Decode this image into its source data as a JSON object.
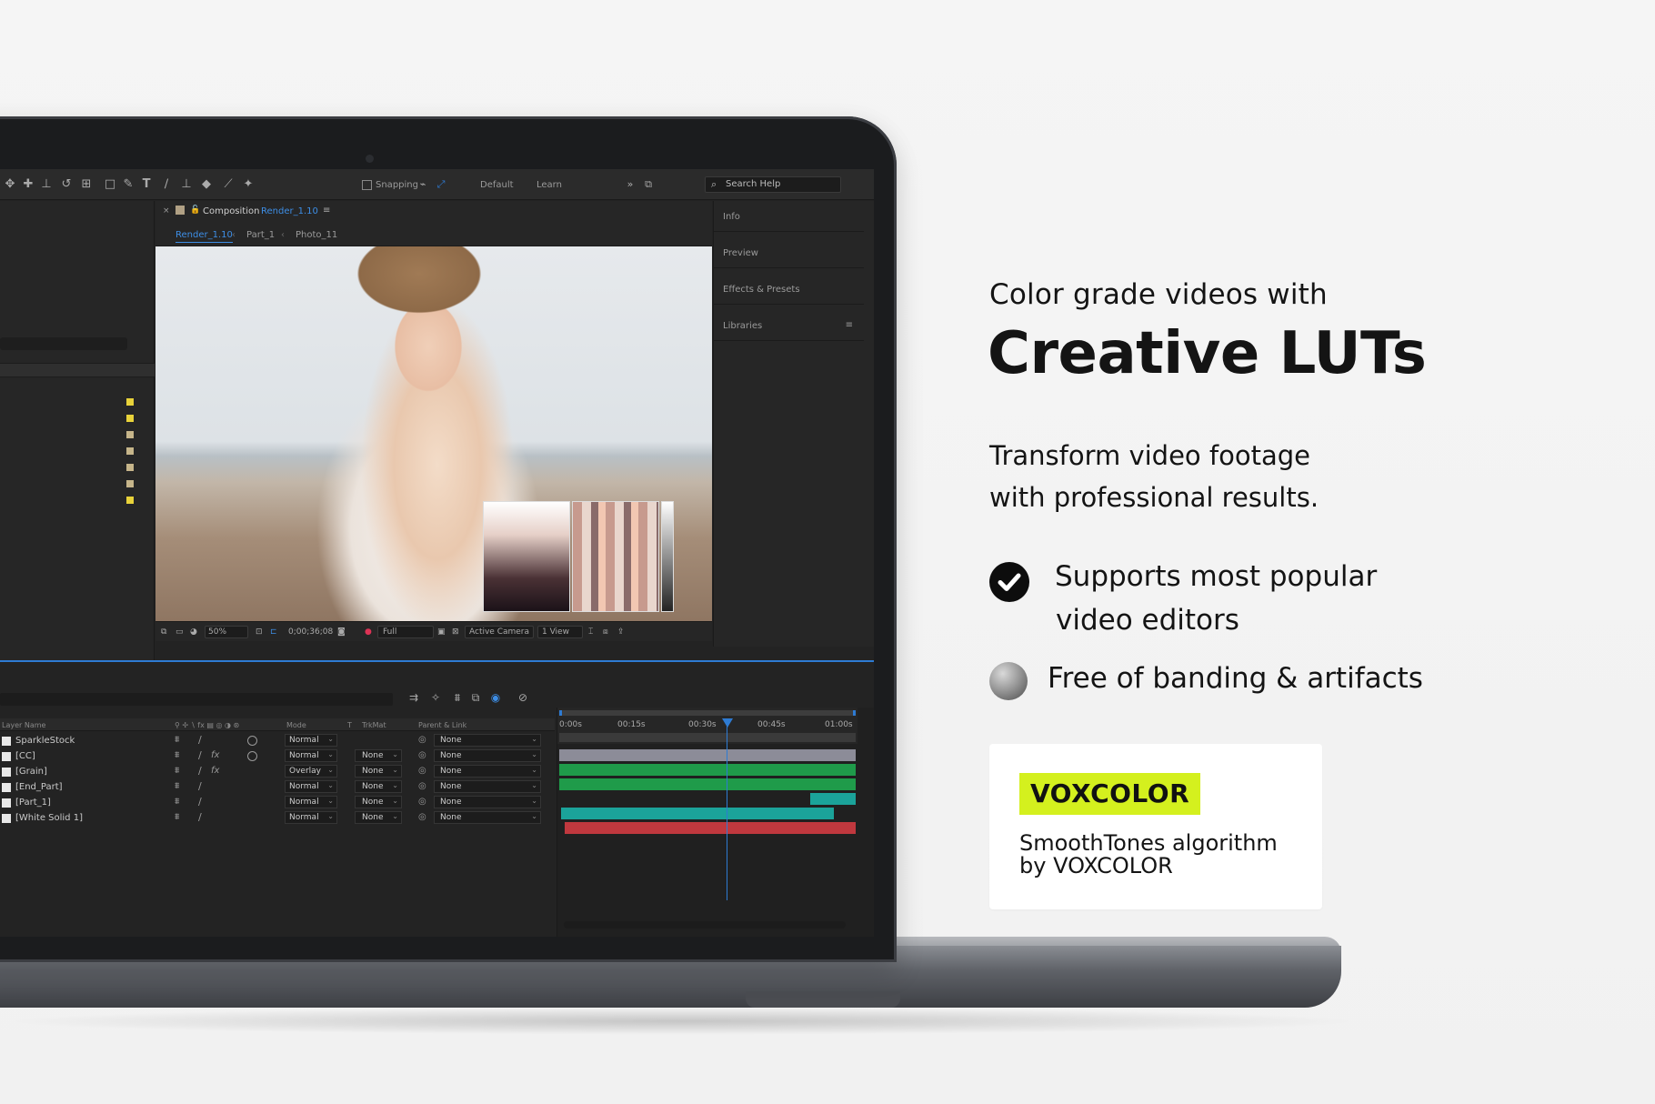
{
  "app": {
    "toolbar": {
      "snapping_label": "Snapping",
      "workspace_default": "Default",
      "workspace_learn": "Learn",
      "search_placeholder": "Search Help"
    },
    "composition": {
      "header_label": "Composition",
      "comp_name": "Render_1.10",
      "breadcrumbs": [
        "Render_1.10",
        "Part_1",
        "Photo_11"
      ]
    },
    "viewer_bar": {
      "zoom": "50%",
      "timecode": "0;00;36;08",
      "resolution": "Full",
      "camera": "Active Camera",
      "views": "1 View"
    },
    "right_panel": {
      "items": [
        "Info",
        "Preview",
        "Effects & Presets",
        "Libraries"
      ]
    },
    "timeline": {
      "columns": {
        "layer_name": "Layer Name",
        "mode": "Mode",
        "t": "T",
        "trkmat": "TrkMat",
        "parent": "Parent & Link"
      },
      "ruler_labels": [
        "0:00s",
        "00:15s",
        "00:30s",
        "00:45s",
        "01:00s"
      ],
      "layers": [
        {
          "name": "SparkleStock",
          "mode": "Normal",
          "trkmat": "",
          "parent": "None",
          "fx": false
        },
        {
          "name": "[CC]",
          "mode": "Normal",
          "trkmat": "None",
          "parent": "None",
          "fx": true
        },
        {
          "name": "[Grain]",
          "mode": "Overlay",
          "trkmat": "None",
          "parent": "None",
          "fx": true
        },
        {
          "name": "[End_Part]",
          "mode": "Normal",
          "trkmat": "None",
          "parent": "None",
          "fx": false
        },
        {
          "name": "[Part_1]",
          "mode": "Normal",
          "trkmat": "None",
          "parent": "None",
          "fx": false
        },
        {
          "name": "[White Solid 1]",
          "mode": "Normal",
          "trkmat": "None",
          "parent": "None",
          "fx": false
        }
      ],
      "track_colors": [
        "#8c8c98",
        "#1f9b4a",
        "#1f9b4a",
        "#1ba39a",
        "#1ba39a",
        "#c0383e"
      ]
    }
  },
  "marketing": {
    "subhead": "Color grade videos with",
    "headline": "Creative LUTs",
    "body_line1": "Transform video footage",
    "body_line2": "with professional results.",
    "bullet1_line1": "Supports most popular",
    "bullet1_line2": "video editors",
    "bullet2": "Free of banding & artifacts",
    "brand": "VOXCOLOR",
    "card_line1": "SmoothTones algorithm",
    "card_line2": "by VOXCOLOR"
  },
  "colors": {
    "accent": "#d4f01e",
    "ae_blue": "#2e7bd3",
    "text": "#141414"
  }
}
